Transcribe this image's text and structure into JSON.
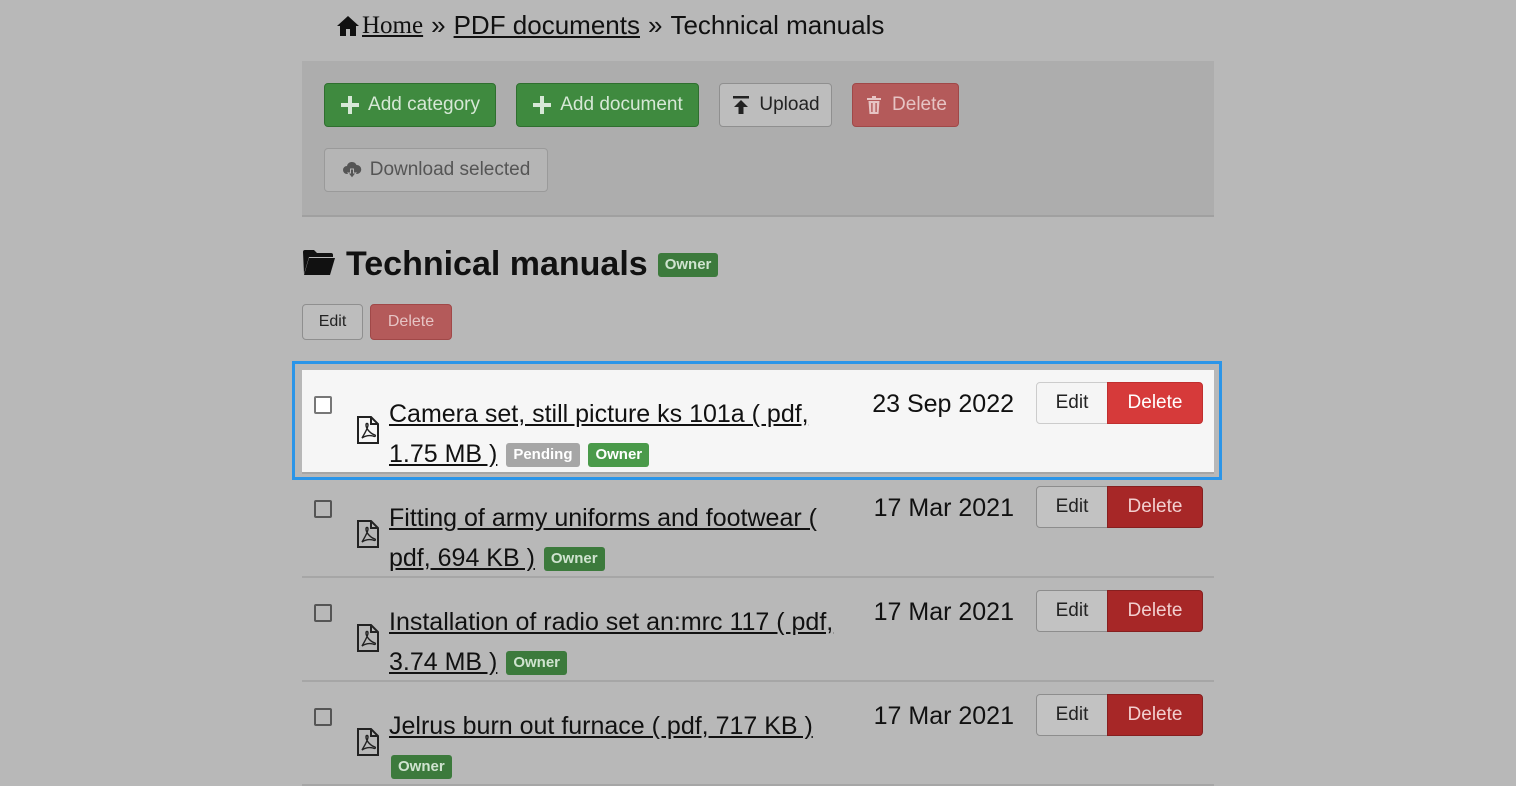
{
  "breadcrumb": {
    "home": "Home",
    "separator": "»",
    "pdf_documents": "PDF documents",
    "current": "Technical manuals"
  },
  "toolbar": {
    "add_category": "Add category",
    "add_document": "Add document",
    "upload": "Upload",
    "delete": "Delete",
    "download_selected": "Download selected"
  },
  "category": {
    "title": "Technical manuals",
    "badge": "Owner",
    "edit": "Edit",
    "delete": "Delete"
  },
  "documents": [
    {
      "title": "Camera set, still picture ks 101a ( pdf, 1.75 MB )",
      "badges": [
        "Pending",
        "Owner"
      ],
      "date": "23 Sep 2022",
      "edit": "Edit",
      "delete": "Delete",
      "focused": true
    },
    {
      "title": "Fitting of army uniforms and footwear ( pdf, 694 KB )",
      "badges": [
        "Owner"
      ],
      "date": "17 Mar 2021",
      "edit": "Edit",
      "delete": "Delete"
    },
    {
      "title": "Installation of radio set an:mrc 117 ( pdf, 3.74 MB )",
      "badges": [
        "Owner"
      ],
      "date": "17 Mar 2021",
      "edit": "Edit",
      "delete": "Delete"
    },
    {
      "title": "Jelrus burn out furnace ( pdf, 717 KB )",
      "badges": [
        "Owner"
      ],
      "date": "17 Mar 2021",
      "edit": "Edit",
      "delete": "Delete"
    }
  ],
  "colors": {
    "focus_ring": "#2b95e8",
    "success": "#3f8a3f",
    "danger": "#d63a3a",
    "overlay_bg": "#b8b8b8"
  },
  "icons": [
    "home-icon",
    "plus-icon",
    "upload-icon",
    "trash-icon",
    "cloud-download-icon",
    "folder-icon",
    "pdf-file-icon",
    "checkbox"
  ]
}
